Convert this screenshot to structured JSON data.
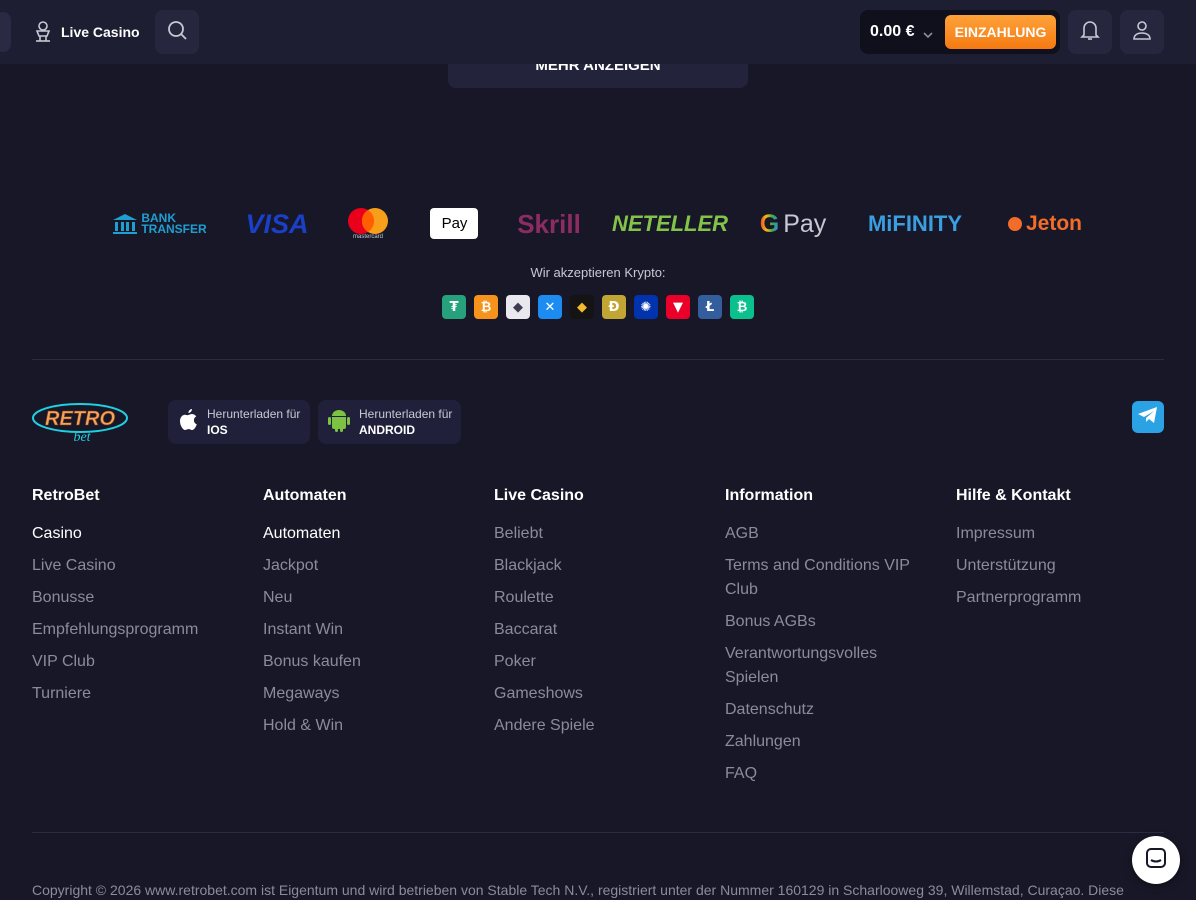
{
  "topbar": {
    "live_casino": "Live Casino",
    "balance": "0.00 €",
    "deposit": "EINZAHLUNG"
  },
  "more_button": "MEHR ANZEIGEN",
  "payments": {
    "bank_line1": "BANK",
    "bank_line2": "TRANSFER",
    "visa": "VISA",
    "mastercard": "mastercard",
    "applepay": "Pay",
    "skrill": "Skrill",
    "neteller": "NETELLER",
    "gpay_g": "G",
    "gpay": "Pay",
    "mifinity": "MiFINITY",
    "jeton": "Jeton"
  },
  "crypto_label": "Wir akzeptieren Krypto:",
  "crypto": [
    {
      "name": "tether",
      "glyph": "₮",
      "color": "#26a17b"
    },
    {
      "name": "bitcoin",
      "glyph": "₿",
      "color": "#f7931a"
    },
    {
      "name": "ethereum",
      "glyph": "◆",
      "color": "#e8e8ee"
    },
    {
      "name": "ripple",
      "glyph": "✕",
      "color": "#1c8cf0"
    },
    {
      "name": "binance",
      "glyph": "◆",
      "color": "#141414"
    },
    {
      "name": "dogecoin",
      "glyph": "Ð",
      "color": "#c2a633"
    },
    {
      "name": "cardano",
      "glyph": "✺",
      "color": "#0033ad"
    },
    {
      "name": "tron",
      "glyph": "▼",
      "color": "#eb0029"
    },
    {
      "name": "litecoin",
      "glyph": "Ł",
      "color": "#345d9d"
    },
    {
      "name": "bitcoin-cash",
      "glyph": "₿",
      "color": "#0ac18e"
    }
  ],
  "apps": {
    "ios_small": "Herunterladen für",
    "ios_big": "IOS",
    "android_small": "Herunterladen für",
    "android_big": "ANDROID"
  },
  "logo": {
    "line1": "RETRO",
    "line2": "bet"
  },
  "columns": [
    {
      "title": "RetroBet",
      "items": [
        {
          "label": "Casino",
          "active": true
        },
        {
          "label": "Live Casino"
        },
        {
          "label": "Bonusse"
        },
        {
          "label": "Empfehlungsprogramm"
        },
        {
          "label": "VIP Club"
        },
        {
          "label": "Turniere"
        }
      ]
    },
    {
      "title": "Automaten",
      "items": [
        {
          "label": "Automaten",
          "active": true
        },
        {
          "label": "Jackpot"
        },
        {
          "label": "Neu"
        },
        {
          "label": "Instant Win"
        },
        {
          "label": "Bonus kaufen"
        },
        {
          "label": "Megaways"
        },
        {
          "label": "Hold & Win"
        }
      ]
    },
    {
      "title": "Live Casino",
      "items": [
        {
          "label": "Beliebt"
        },
        {
          "label": "Blackjack"
        },
        {
          "label": "Roulette"
        },
        {
          "label": "Baccarat"
        },
        {
          "label": "Poker"
        },
        {
          "label": "Gameshows"
        },
        {
          "label": "Andere Spiele"
        }
      ]
    },
    {
      "title": "Information",
      "items": [
        {
          "label": "AGB"
        },
        {
          "label": "Terms and Conditions VIP Club"
        },
        {
          "label": "Bonus AGBs"
        },
        {
          "label": "Verantwortungsvolles Spielen"
        },
        {
          "label": "Datenschutz"
        },
        {
          "label": "Zahlungen"
        },
        {
          "label": "FAQ"
        }
      ]
    },
    {
      "title": "Hilfe & Kontakt",
      "items": [
        {
          "label": "Impressum"
        },
        {
          "label": "Unterstützung"
        },
        {
          "label": "Partnerprogramm"
        }
      ]
    }
  ],
  "copyright": "Copyright © 2026 www.retrobet.com ist Eigentum und wird betrieben von Stable Tech N.V., registriert unter der Nummer 160129 in Scharlooweg 39, Willemstad, Curaçao. Diese"
}
